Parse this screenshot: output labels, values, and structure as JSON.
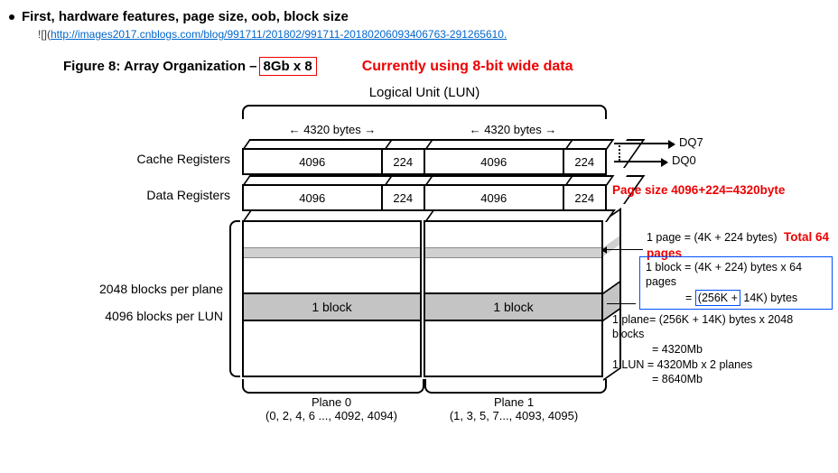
{
  "heading": "First, hardware features, page size, oob, block size",
  "md_link_prefix": "![](",
  "md_link_url": "http://images2017.cnblogs.com/blog/991711/201802/991711-20180206093406763-291265610.",
  "figure_caption_prefix": "Figure 8: Array Organization – ",
  "figure_chip": "8Gb x 8",
  "note_8bit": "Currently using 8-bit wide data",
  "lun_title": "Logical Unit (LUN)",
  "dim_bytes": "4320 bytes",
  "cache_reg_label": "Cache Registers",
  "data_reg_label": "Data Registers",
  "cell_4096": "4096",
  "cell_224": "224",
  "dq7": "DQ7",
  "dq0": "DQ0",
  "page_size_note": "Page size 4096+224=4320byte",
  "page_eq": "1 page = (4K + 224 bytes)",
  "total_pages_note": "Total 64 pages",
  "block_eq_line1": "1 block = (4K + 224) bytes x 64 pages",
  "block_eq_line2_pre": "= ",
  "block_eq_256k": "(256K +",
  "block_eq_line2_post": " 14K) bytes",
  "plane_eq_line1": "1 plane= (256K + 14K) bytes x 2048 blocks",
  "plane_eq_line2": "= 4320Mb",
  "lun_eq_line1": "1 LUN   = 4320Mb x 2 planes",
  "lun_eq_line2": "= 8640Mb",
  "blocks_per_plane": "2048 blocks per plane",
  "blocks_per_lun": "4096 blocks per LUN",
  "one_block": "1 block",
  "plane0": "Plane 0",
  "plane0_idx": "(0, 2, 4, 6 ..., 4092, 4094)",
  "plane1": "Plane 1",
  "plane1_idx": "(1, 3, 5, 7..., 4093, 4095)"
}
